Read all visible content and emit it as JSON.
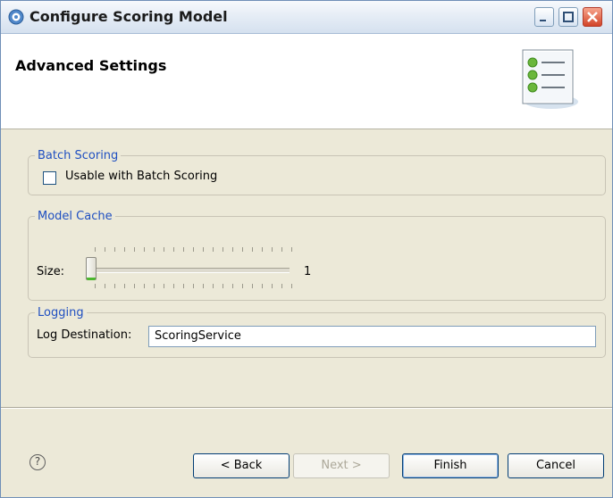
{
  "window": {
    "title": "Configure Scoring Model"
  },
  "header": {
    "title": "Advanced Settings"
  },
  "groups": {
    "batch": {
      "legend": "Batch Scoring",
      "checkbox_label": "Usable with Batch Scoring",
      "checked": false
    },
    "cache": {
      "legend": "Model Cache",
      "size_label": "Size:",
      "size_value": "1"
    },
    "logging": {
      "legend": "Logging",
      "destination_label": "Log Destination:",
      "destination_value": "ScoringService"
    }
  },
  "footer": {
    "help_glyph": "?",
    "back_label": "< Back",
    "next_label": "Next >",
    "finish_label": "Finish",
    "cancel_label": "Cancel"
  },
  "icons": {
    "app": "app-icon",
    "header": "list-settings-icon",
    "help": "help-icon"
  }
}
